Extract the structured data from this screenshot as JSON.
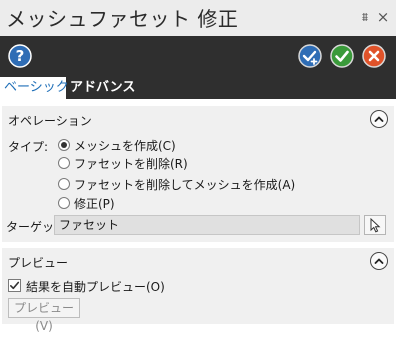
{
  "window": {
    "title": "メッシュファセット 修正",
    "pin_glyph": "⩩",
    "close_glyph": "×"
  },
  "toolbar": {
    "help_icon": "help-icon",
    "apply_icon": "apply-plus-icon",
    "ok_icon": "ok-check-icon",
    "cancel_icon": "cancel-x-icon",
    "colors": {
      "help": "#2f6db5",
      "apply": "#2f6db5",
      "ok": "#3a9a3a",
      "cancel": "#e0532a"
    }
  },
  "tabs": [
    {
      "label": "ベーシック",
      "active": true
    },
    {
      "label": "アドバンス",
      "active": false
    }
  ],
  "operation": {
    "header": "オペレーション",
    "type_label": "タイプ:",
    "options": [
      {
        "label": "メッシュを作成(C)",
        "checked": true
      },
      {
        "label": "ファセットを削除(R)",
        "checked": false
      },
      {
        "label": "ファセットを削除してメッシュを作成(A)",
        "checked": false
      },
      {
        "label": "修正(P)",
        "checked": false
      }
    ],
    "target_label": "ターゲット:",
    "target_value": "ファセット"
  },
  "preview": {
    "header": "プレビュー",
    "auto_preview_label": "結果を自動プレビュー(O)",
    "auto_preview_checked": true,
    "preview_button": "プレビュー(V)"
  }
}
